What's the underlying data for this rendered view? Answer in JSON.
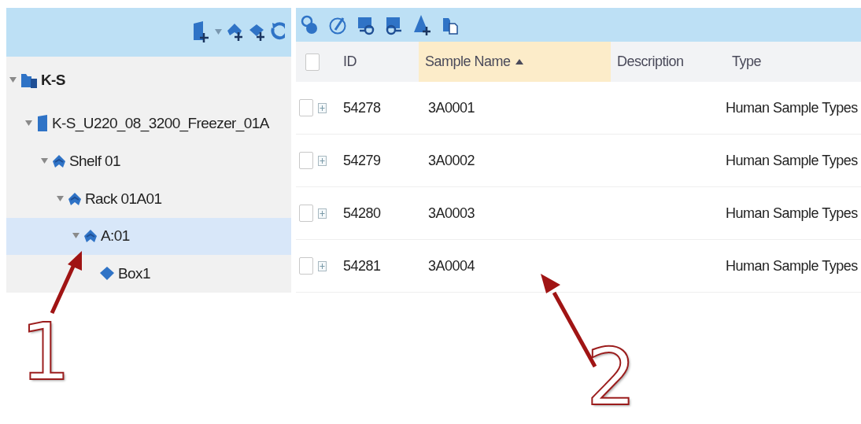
{
  "tree_panel": {
    "toolbar": {
      "has_dropdown": true
    },
    "tree": [
      {
        "label": "K-S",
        "kind": "site",
        "expanded": true,
        "selected": false,
        "children": [
          {
            "label": "K-S_U220_08_3200_Freezer_01A",
            "kind": "freezer",
            "expanded": true,
            "selected": false,
            "children": [
              {
                "label": "Shelf 01",
                "kind": "shelf",
                "expanded": true,
                "selected": false,
                "children": [
                  {
                    "label": "Rack 01A01",
                    "kind": "shelf",
                    "expanded": true,
                    "selected": false,
                    "children": [
                      {
                        "label": "A:01",
                        "kind": "shelf",
                        "expanded": true,
                        "selected": true,
                        "children": [
                          {
                            "label": "Box1",
                            "kind": "box",
                            "selected": false
                          }
                        ]
                      }
                    ]
                  }
                ]
              }
            ]
          }
        ]
      }
    ]
  },
  "sample_panel": {
    "columns": [
      {
        "label": "ID",
        "sorted": false
      },
      {
        "label": "Sample Name",
        "sorted": true
      },
      {
        "label": "Description",
        "sorted": false
      },
      {
        "label": "Type",
        "sorted": false
      }
    ],
    "header_checked": false,
    "rows": [
      {
        "checked": false,
        "id": "54278",
        "sample_name": "3A0001",
        "type": "Human Sample Types"
      },
      {
        "checked": false,
        "id": "54279",
        "sample_name": "3A0002",
        "type": "Human Sample Types"
      },
      {
        "checked": false,
        "id": "54280",
        "sample_name": "3A0003",
        "type": "Human Sample Types"
      },
      {
        "checked": false,
        "id": "54281",
        "sample_name": "3A0004",
        "type": "Human Sample Types"
      }
    ]
  },
  "annotations": [
    {
      "label": "1"
    },
    {
      "label": "2"
    }
  ]
}
